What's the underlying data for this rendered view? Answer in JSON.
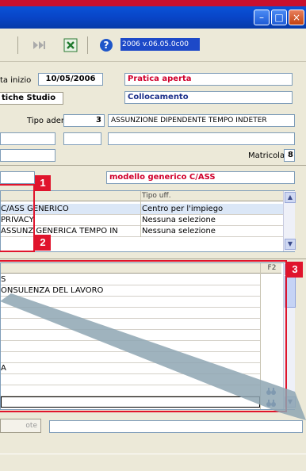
{
  "toolbar": {
    "icons": [
      "forward-icon",
      "excel-icon",
      "help-icon"
    ],
    "version": "2006 v.06.05.0c00"
  },
  "header": {
    "data_inizio_label": "ta inizio",
    "data_inizio_value": "10/05/2006",
    "stato_pratica": "Pratica aperta",
    "tab_label": "tiche Studio",
    "collocamento": "Collocamento",
    "tipo_adempimento_label": "Tipo ademp.",
    "tipo_adempimento_code": "3",
    "tipo_adempimento_desc": "ASSUNZIONE DIPENDENTE TEMPO INDETER",
    "matricola_label": "Matricola",
    "matricola_value": "8"
  },
  "modello": {
    "label": "modello generico C/ASS",
    "column_tipo_uff": "Tipo uff.",
    "rows": [
      {
        "name": "C/ASS GENERICO",
        "tipo": "Centro per l'impiego"
      },
      {
        "name": "PRIVACY",
        "tipo": "Nessuna selezione"
      },
      {
        "name": "ASSUNZ    GENERICA TEMPO IN",
        "tipo": "Nessuna selezione"
      }
    ]
  },
  "callouts": {
    "one": "1",
    "two": "2",
    "three": "3"
  },
  "documents": {
    "column_key": "F2",
    "rows": [
      "S",
      "ONSULENZA DEL LAVORO",
      "",
      "",
      "",
      "",
      "",
      "",
      "A",
      "",
      "",
      "",
      "",
      ""
    ]
  },
  "bottom": {
    "button_label": "ote"
  },
  "colors": {
    "accent_red": "#e0142c",
    "title_blue": "#0845c8"
  }
}
